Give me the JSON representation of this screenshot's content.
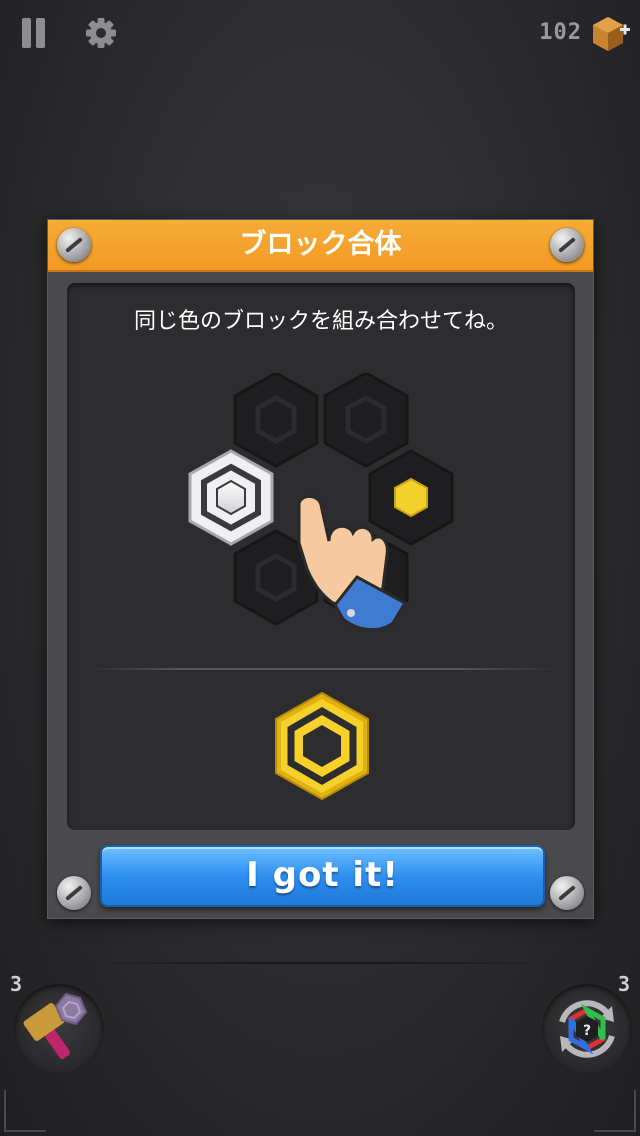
{
  "hud": {
    "coins": "102",
    "pause_icon": "pause-icon",
    "settings_icon": "gear-icon",
    "coin_icon": "bronze-hex-coin-plus-icon"
  },
  "dialog": {
    "title": "ブロック合体",
    "instruction": "同じ色のブロックを組み合わせてね。",
    "button_label": "I got it!"
  },
  "tools": {
    "hammer_count": "3",
    "shuffle_count": "3",
    "hammer_icon": "hammer-icon",
    "shuffle_icon": "rainbow-shuffle-icon"
  },
  "colors": {
    "header": "#f5a530",
    "button": "#2d8ff0",
    "gold": "#f2c81e"
  }
}
